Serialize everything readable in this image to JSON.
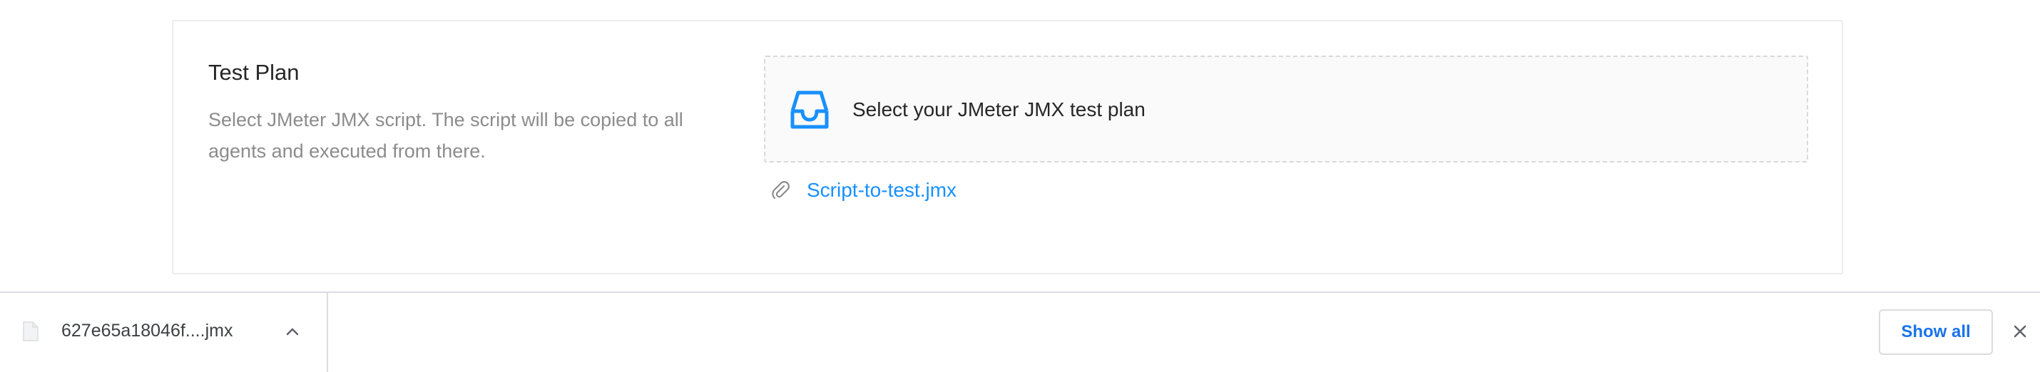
{
  "test_plan": {
    "title": "Test Plan",
    "description": "Select JMeter JMX script. The script will be copied to all agents and executed from there.",
    "dropzone_text": "Select your JMeter JMX test plan",
    "uploaded_file": "Script-to-test.jmx",
    "accent_color": "#1890ff"
  },
  "download_bar": {
    "file_name": "627e65a18046f....jmx",
    "show_all_label": "Show all",
    "icons": {
      "file": "file-icon",
      "expand": "chevron-up-icon",
      "close": "close-icon"
    },
    "accent_color": "#1a73e8"
  }
}
